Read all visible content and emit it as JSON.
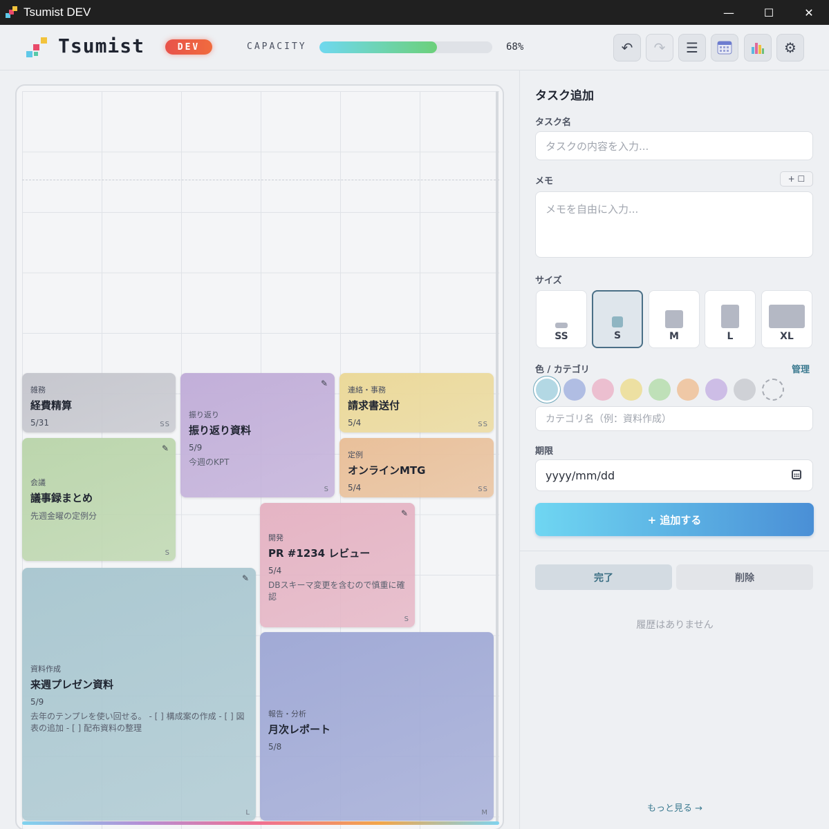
{
  "window": {
    "title": "Tsumist DEV",
    "minimize": "—",
    "maximize": "☐",
    "close": "✕"
  },
  "header": {
    "brand": "Tsumist",
    "badge": "DEV",
    "capacity_label": "CAPACITY",
    "capacity_value": "68%",
    "capacity_fraction": 0.68,
    "buttons": {
      "undo": "↶",
      "redo": "↷",
      "list": "☰",
      "calendar_icon": "calendar-icon",
      "chart_icon": "bar-chart-icon",
      "settings": "⚙"
    }
  },
  "board": {
    "cards": [
      {
        "category": "雑務",
        "name": "経費精算",
        "due": "5/31",
        "memo": "",
        "size": "SS",
        "color": "#c6c7ce",
        "edited": false
      },
      {
        "category": "振り返り",
        "name": "振り返り資料",
        "due": "5/9",
        "memo": "今週のKPT",
        "size": "S",
        "color": "#c2afd9",
        "edited": true
      },
      {
        "category": "連絡・事務",
        "name": "請求書送付",
        "due": "5/4",
        "memo": "",
        "size": "SS",
        "color": "#ebd99a",
        "edited": false
      },
      {
        "category": "会議",
        "name": "議事録まとめ",
        "due": "",
        "memo": "先週金曜の定例分",
        "size": "S",
        "color": "#bcd6ad",
        "edited": true
      },
      {
        "category": "定例",
        "name": "オンラインMTG",
        "due": "5/4",
        "memo": "",
        "size": "SS",
        "color": "#e9c09a",
        "edited": false
      },
      {
        "category": "開発",
        "name": "PR #1234 レビュー",
        "due": "5/4",
        "memo": "DBスキーマ変更を含むので慎重に確認",
        "size": "S",
        "color": "#e5b4c4",
        "edited": true
      },
      {
        "category": "資料作成",
        "name": "来週プレゼン資料",
        "due": "5/9",
        "memo": "去年のテンプレを使い回せる。 - [ ] 構成案の作成 - [ ] 図表の追加 - [ ] 配布資料の整理",
        "size": "L",
        "color": "#abc8d1",
        "edited": true
      },
      {
        "category": "報告・分析",
        "name": "月次レポート",
        "due": "5/8",
        "memo": "",
        "size": "M",
        "color": "#a1aad6",
        "edited": false
      }
    ]
  },
  "panel": {
    "title": "タスク追加",
    "task_name_label": "タスク名",
    "task_name_placeholder": "タスクの内容を入力...",
    "memo_label": "メモ",
    "memo_add_button": "+ ☐",
    "memo_placeholder": "メモを自由に入力...",
    "size_label": "サイズ",
    "sizes": [
      "SS",
      "S",
      "M",
      "L",
      "XL"
    ],
    "selected_size": "S",
    "color_label": "色 / カテゴリ",
    "manage_link": "管理",
    "colors": [
      "#b3d8e4",
      "#b0bde3",
      "#ecbfd0",
      "#ede0a2",
      "#bfe0b8",
      "#efc8a6",
      "#cdbde6",
      "#cfd1d6"
    ],
    "category_placeholder": "カテゴリ名（例：資料作成）",
    "due_label": "期限",
    "due_value": "yyyy/mm/dd",
    "add_button": "+ 追加する",
    "tab_done": "完了",
    "tab_deleted": "削除",
    "history_empty": "履歴はありません",
    "more_link": "もっと見る →"
  }
}
